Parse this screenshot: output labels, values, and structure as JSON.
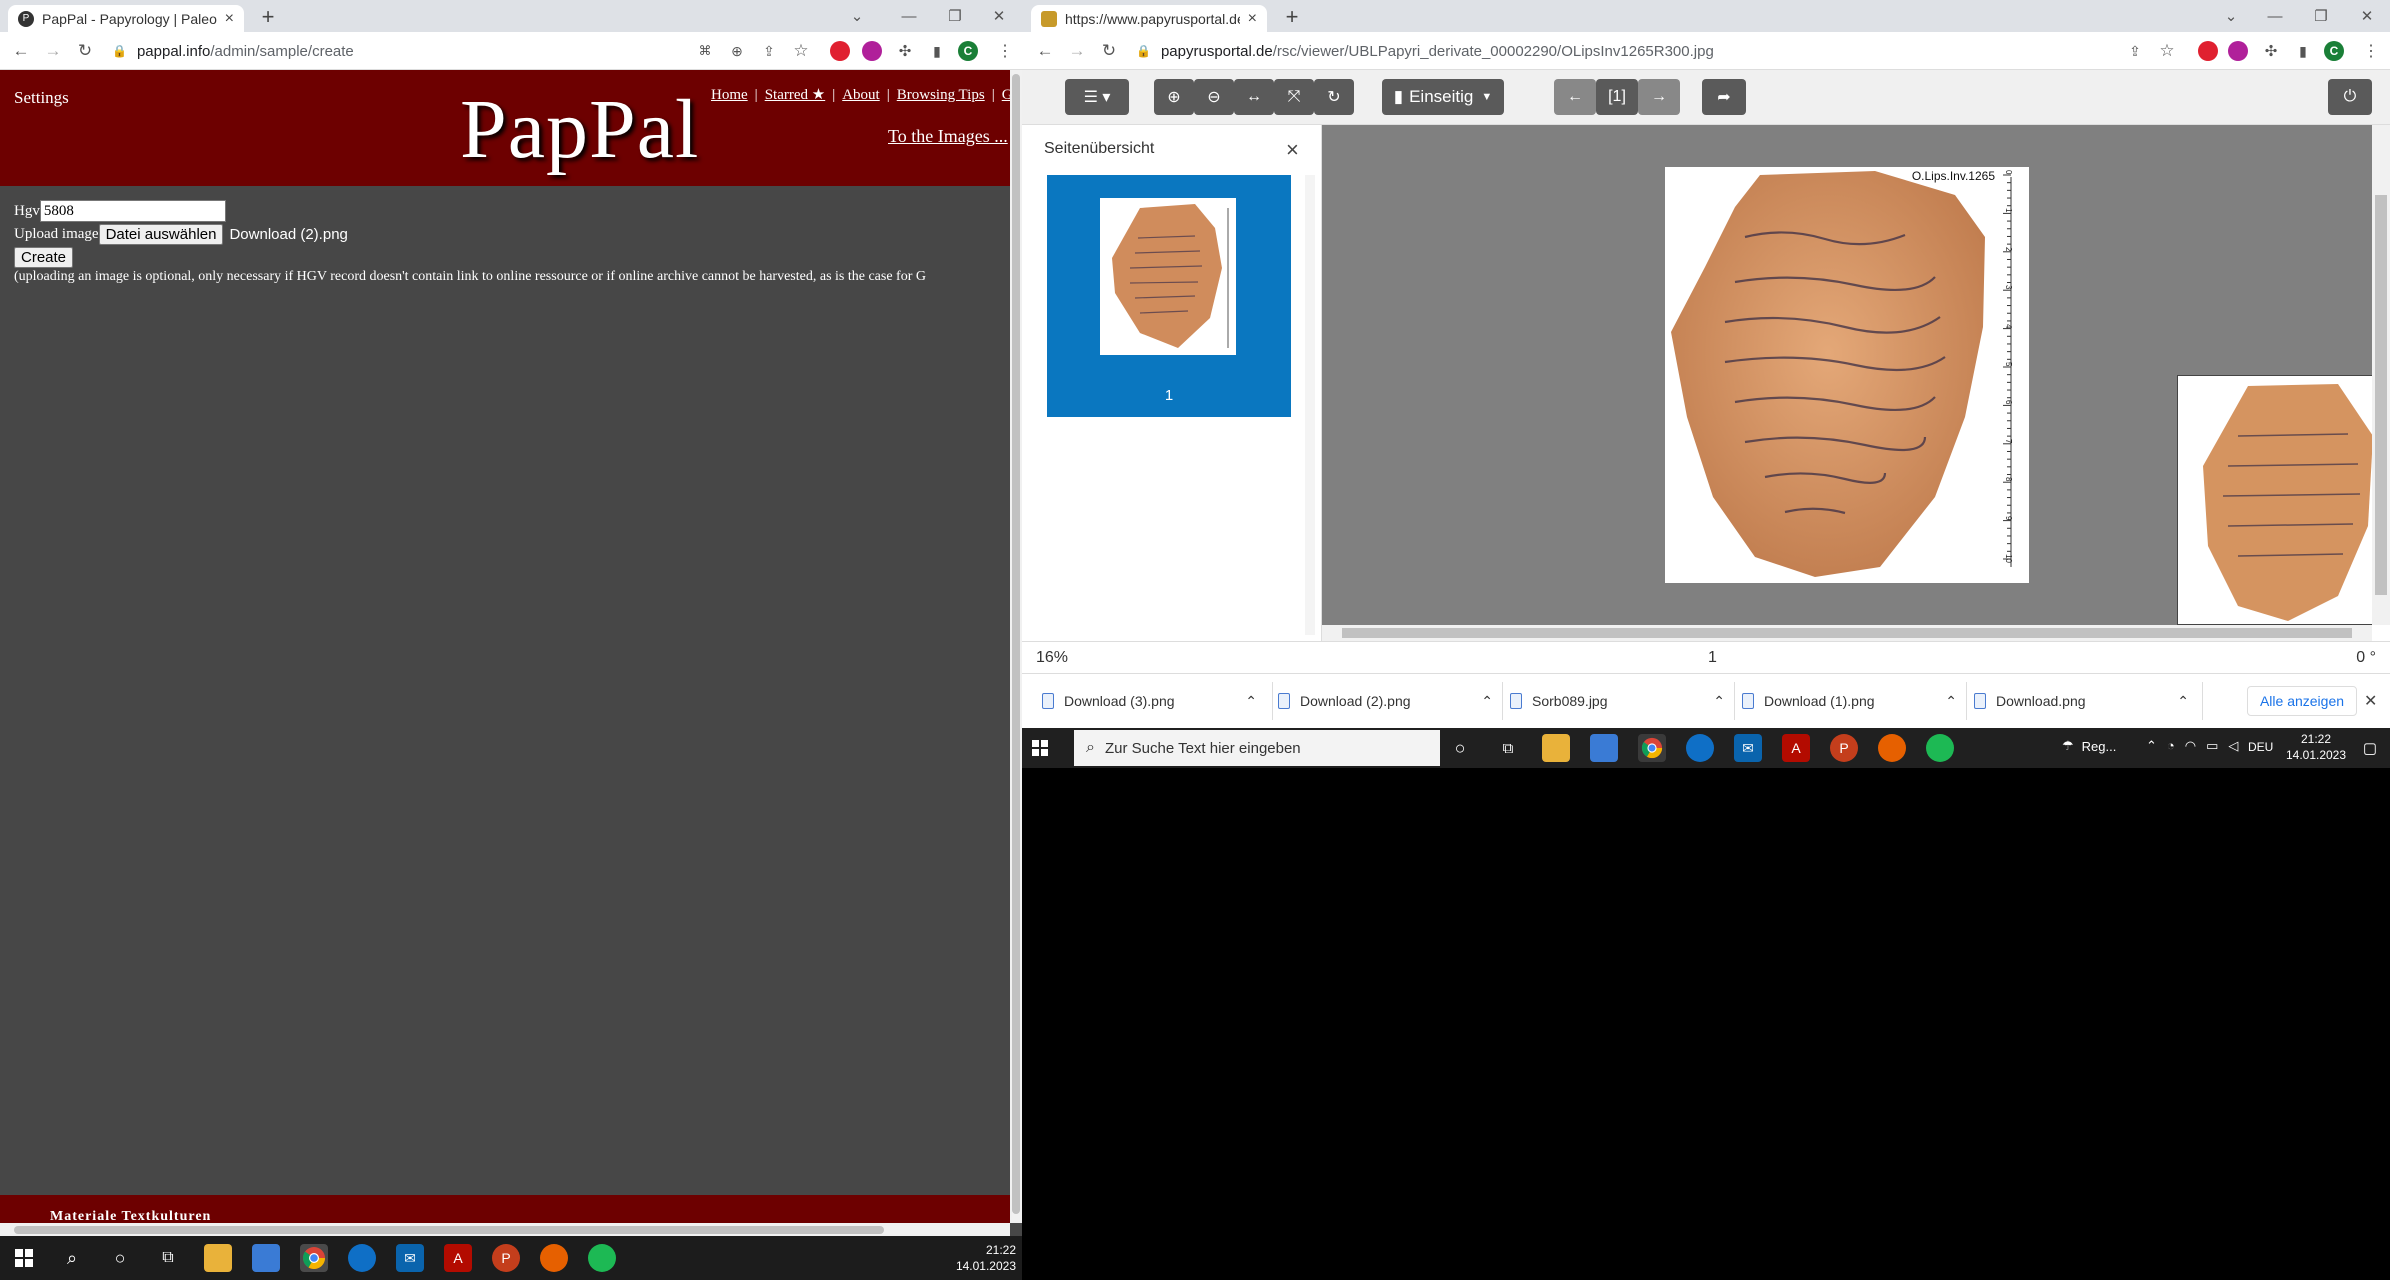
{
  "left_browser": {
    "tab": {
      "title": "PapPal - Papyrology | Paleograph",
      "close": "×"
    },
    "new_tab": "+",
    "window_controls": {
      "caret": "⌄",
      "minimize": "—",
      "restore": "❐",
      "close": "✕"
    },
    "url": {
      "domain": "pappal.info",
      "path": "/admin/sample/create"
    },
    "profile_initial": "C",
    "page": {
      "settings": "Settings",
      "logo": "PapPal",
      "nav": [
        "Home",
        "Starred ★",
        "About",
        "Browsing Tips",
        "G"
      ],
      "nav_sep": "|",
      "to_images": "To the Images ...",
      "hgv_label": "Hgv",
      "hgv_value": "5808",
      "upload_label": "Upload image",
      "file_button": "Datei auswählen",
      "file_name": "Download (2).png",
      "create_button": "Create",
      "note": "(uploading an image is optional, only necessary if HGV record doesn't contain link to online ressource or if online archive cannot be harvested, as is the case for G",
      "footer": "Materiale Textkulturen"
    },
    "taskbar": {
      "time": "21:22",
      "date": "14.01.2023"
    }
  },
  "right_browser": {
    "tab": {
      "title": "https://www.papyrusportal.de/rsc",
      "close": "×"
    },
    "new_tab": "+",
    "window_controls": {
      "caret": "⌄",
      "minimize": "—",
      "restore": "❐",
      "close": "✕"
    },
    "url": {
      "domain": "papyrusportal.de",
      "path": "/rsc/viewer/UBLPapyri_derivate_00002290/OLipsInv1265R300.jpg"
    },
    "profile_initial": "C",
    "viewer": {
      "view_mode": "Einseitig",
      "page_indicator": "[1]",
      "sidebar_title": "Seitenübersicht",
      "sidebar_close": "×",
      "thumb_page": "1",
      "image_label": "O.Lips.Inv.1265",
      "ruler_ticks": [
        "0",
        "1",
        "2",
        "3",
        "4",
        "5",
        "6",
        "7",
        "8",
        "9",
        "10"
      ],
      "zoom": "16%",
      "page": "1",
      "rotation": "0 °"
    },
    "downloads": [
      "Download (3).png",
      "Download (2).png",
      "Sorb089.jpg",
      "Download (1).png",
      "Download.png"
    ],
    "downloads_show_all": "Alle anzeigen",
    "downloads_close": "✕",
    "taskbar": {
      "search_placeholder": "Zur Suche Text hier eingeben",
      "weather": "Reg...",
      "lang": "DEU",
      "time": "21:22",
      "date": "14.01.2023"
    }
  },
  "colors": {
    "pappal_red": "#6d0000",
    "pappal_bg": "#474747",
    "viewer_gray": "#808080",
    "thumb_blue": "#0a77c0",
    "link_blue": "#1a73e8"
  }
}
